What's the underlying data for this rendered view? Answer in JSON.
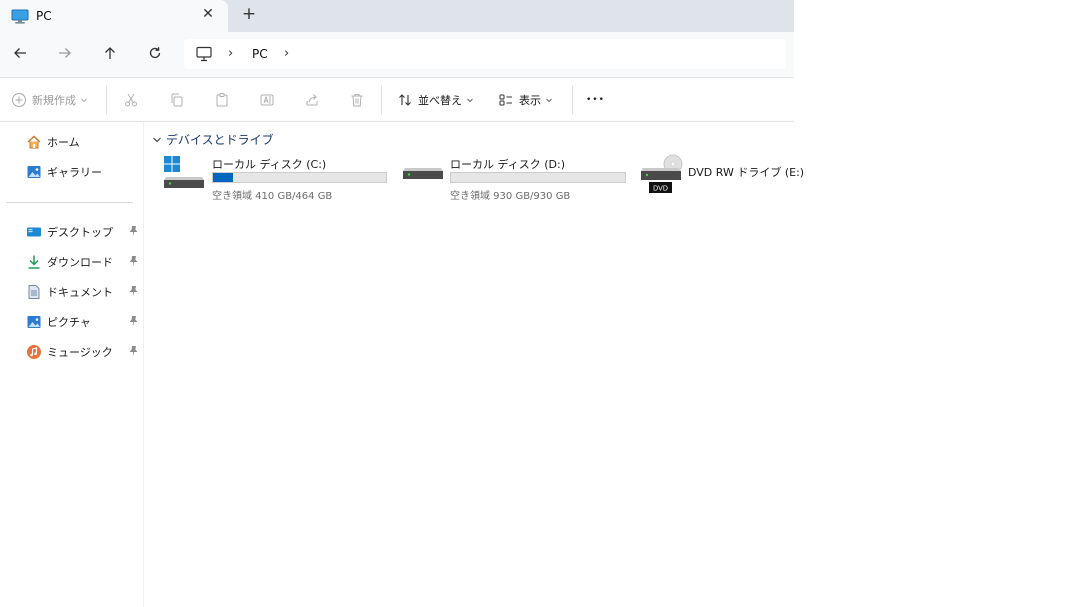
{
  "tab": {
    "title": "PC",
    "close_glyph": "✕",
    "new_tab_glyph": "+"
  },
  "address": {
    "path": [
      "PC"
    ]
  },
  "toolbar": {
    "new_label": "新規作成",
    "sort_label": "並べ替え",
    "view_label": "表示",
    "more_glyph": "•••"
  },
  "sidebar": {
    "top_items": [
      {
        "label": "ホーム",
        "icon": "home-icon"
      },
      {
        "label": "ギャラリー",
        "icon": "gallery-icon"
      }
    ],
    "pinned_items": [
      {
        "label": "デスクトップ",
        "icon": "desktop-icon"
      },
      {
        "label": "ダウンロード",
        "icon": "download-icon"
      },
      {
        "label": "ドキュメント",
        "icon": "documents-icon"
      },
      {
        "label": "ピクチャ",
        "icon": "pictures-icon"
      },
      {
        "label": "ミュージック",
        "icon": "music-icon"
      }
    ]
  },
  "content": {
    "group_label": "デバイスとドライブ",
    "drives": [
      {
        "name": "ローカル ディスク (C:)",
        "free_text": "空き領域 410 GB/464 GB",
        "used_fraction": 0.116,
        "type": "system"
      },
      {
        "name": "ローカル ディスク (D:)",
        "free_text": "空き領域 930 GB/930 GB",
        "used_fraction": 0.0,
        "type": "hdd"
      },
      {
        "name": "DVD RW ドライブ (E:)",
        "badge": "DVD",
        "type": "dvd"
      }
    ]
  },
  "colors": {
    "accent": "#0067c0",
    "titlebar": "#dfe3ea",
    "navbar": "#f7f9fb"
  }
}
